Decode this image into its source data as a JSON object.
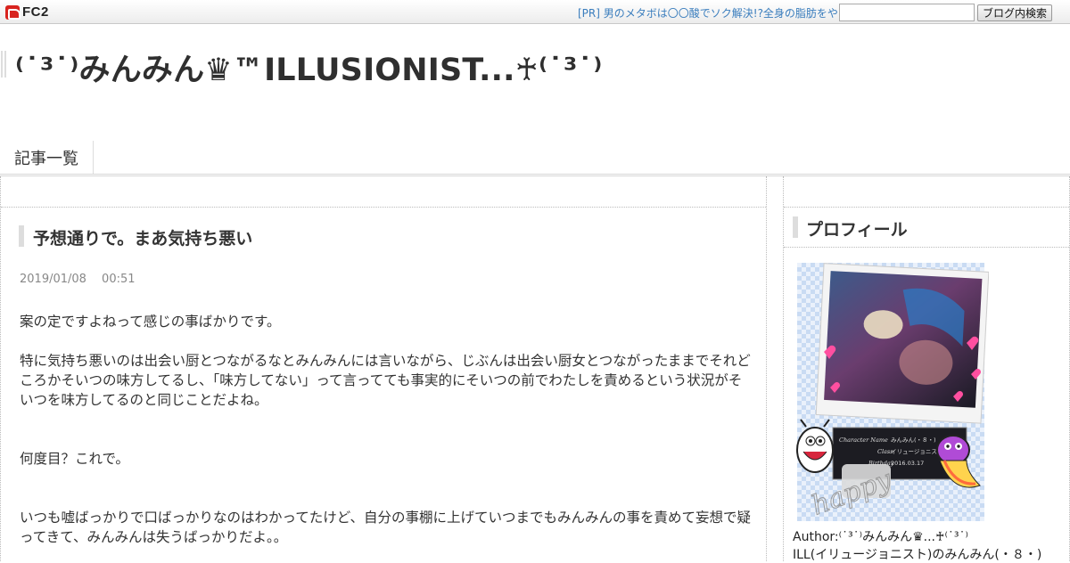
{
  "topbar": {
    "logo_text": "FC2",
    "pr_text": "[PR] 男のメタボは〇〇酸でソク解決!?全身の脂肪をや",
    "search_value": "",
    "search_button": "ブログ内検索"
  },
  "blog": {
    "title": "⁽˙³˙⁾みんみん♛™ILLUSIONIST...♰⁽˙³˙⁾"
  },
  "nav": {
    "items": [
      "記事一覧"
    ]
  },
  "entry": {
    "title": "予想通りで。まあ気持ち悪い",
    "date": "2019/01/08　 00:51",
    "paragraphs": [
      "案の定ですよねって感じの事ばかりです。",
      "特に気持ち悪いのは出会い厨とつながるなとみんみんには言いながら、じぶんは出会い厨女とつながったままでそれどころかそいつの味方してるし、「味方してない」って言ってても事実的にそいつの前でわたしを責めるという状況がそいつを味方してるのと同じことだよね。",
      "何度目？これで。",
      "いつも嘘ばっかりで口ばっかりなのはわかってたけど、自分の事棚に上げていつまでもみんみんの事を責めて妄想で疑ってきて、みんみんは失うばっかりだよ。。"
    ]
  },
  "sidebar": {
    "profile_title": "プロフィール",
    "image_caption": {
      "name_label": "Character Name",
      "name_value": "みんみん(・８・)",
      "class_label": "Class",
      "class_value": "イリュージョニスト",
      "birthday_label": "Birthday",
      "birthday_value": "2016.03.17",
      "sticker_text": "happy"
    },
    "author": "Author:⁽˙³˙⁾みんみん♛...♰⁽˙³˙⁾",
    "author_desc": "ILL(イリュージョニスト)のみんみん(・８・)"
  },
  "colors": {
    "link": "#3a7dbd",
    "logo_red": "#d8231e",
    "accent_bar": "#dddddd"
  }
}
